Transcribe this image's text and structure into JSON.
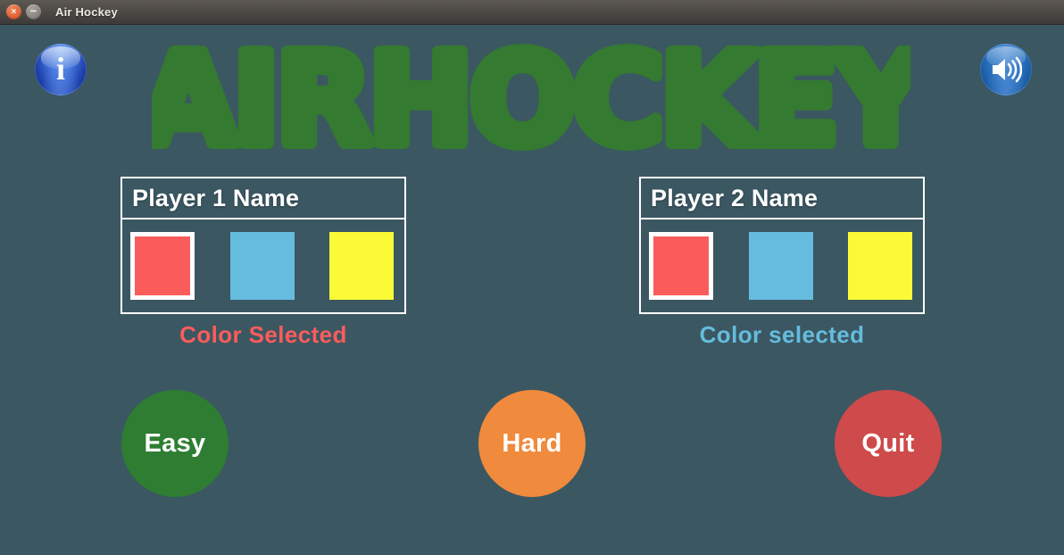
{
  "window": {
    "title": "Air Hockey",
    "close_glyph": "×",
    "minimize_glyph": "–",
    "background_color": "#3b5762"
  },
  "toolbar": {
    "info_button": {
      "name": "info-button",
      "glyph": "i",
      "color": "#2f5fc4"
    },
    "sound_button": {
      "name": "sound-button",
      "icon": "speaker-icon",
      "color": "#2f77c4"
    }
  },
  "logo": {
    "text": "AIRHOCKEY",
    "color": "#347a30"
  },
  "players": [
    {
      "id": "player1",
      "name_value": "Player 1 Name",
      "name_placeholder": "Player 1 Name",
      "status_label": "Color Selected",
      "status_color": "#fa5c5c",
      "selected_color_index": 0,
      "swatches": [
        {
          "name": "red",
          "color": "#fa5c5c",
          "selected": true
        },
        {
          "name": "cyan",
          "color": "#65bcde",
          "selected": false
        },
        {
          "name": "yellow",
          "color": "#fafa37",
          "selected": false
        }
      ]
    },
    {
      "id": "player2",
      "name_value": "Player 2 Name",
      "name_placeholder": "Player 2 Name",
      "status_label": "Color selected",
      "status_color": "#65bcde",
      "selected_color_index": 0,
      "swatches": [
        {
          "name": "red",
          "color": "#fa5c5c",
          "selected": true
        },
        {
          "name": "cyan",
          "color": "#65bcde",
          "selected": false
        },
        {
          "name": "yellow",
          "color": "#fafa37",
          "selected": false
        }
      ]
    }
  ],
  "actions": [
    {
      "id": "easy",
      "label": "Easy",
      "color": "#2e7d32"
    },
    {
      "id": "hard",
      "label": "Hard",
      "color": "#f08a3c"
    },
    {
      "id": "quit",
      "label": "Quit",
      "color": "#cf4a4a"
    }
  ]
}
